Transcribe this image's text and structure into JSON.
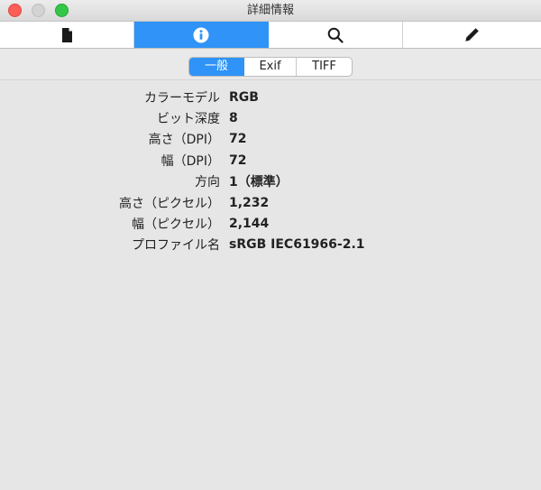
{
  "window": {
    "title": "詳細情報"
  },
  "toolbar": {
    "tools": [
      {
        "icon": "document-icon"
      },
      {
        "icon": "info-icon",
        "active": true
      },
      {
        "icon": "search-icon"
      },
      {
        "icon": "pencil-icon"
      }
    ]
  },
  "segments": {
    "items": [
      "一般",
      "Exif",
      "TIFF"
    ],
    "selected": "一般"
  },
  "info": {
    "rows": [
      {
        "label": "カラーモデル",
        "value": "RGB"
      },
      {
        "label": "ビット深度",
        "value": "8"
      },
      {
        "label": "高さ（DPI）",
        "value": "72"
      },
      {
        "label": "幅（DPI）",
        "value": "72"
      },
      {
        "label": "方向",
        "value": "1（標準）"
      },
      {
        "label": "高さ（ピクセル）",
        "value": "1,232"
      },
      {
        "label": "幅（ピクセル）",
        "value": "2,144"
      },
      {
        "label": "プロファイル名",
        "value": "sRGB IEC61966-2.1"
      }
    ]
  },
  "colors": {
    "accent": "#2f93f7",
    "close": "#fc5f57",
    "zoom": "#33c748"
  }
}
